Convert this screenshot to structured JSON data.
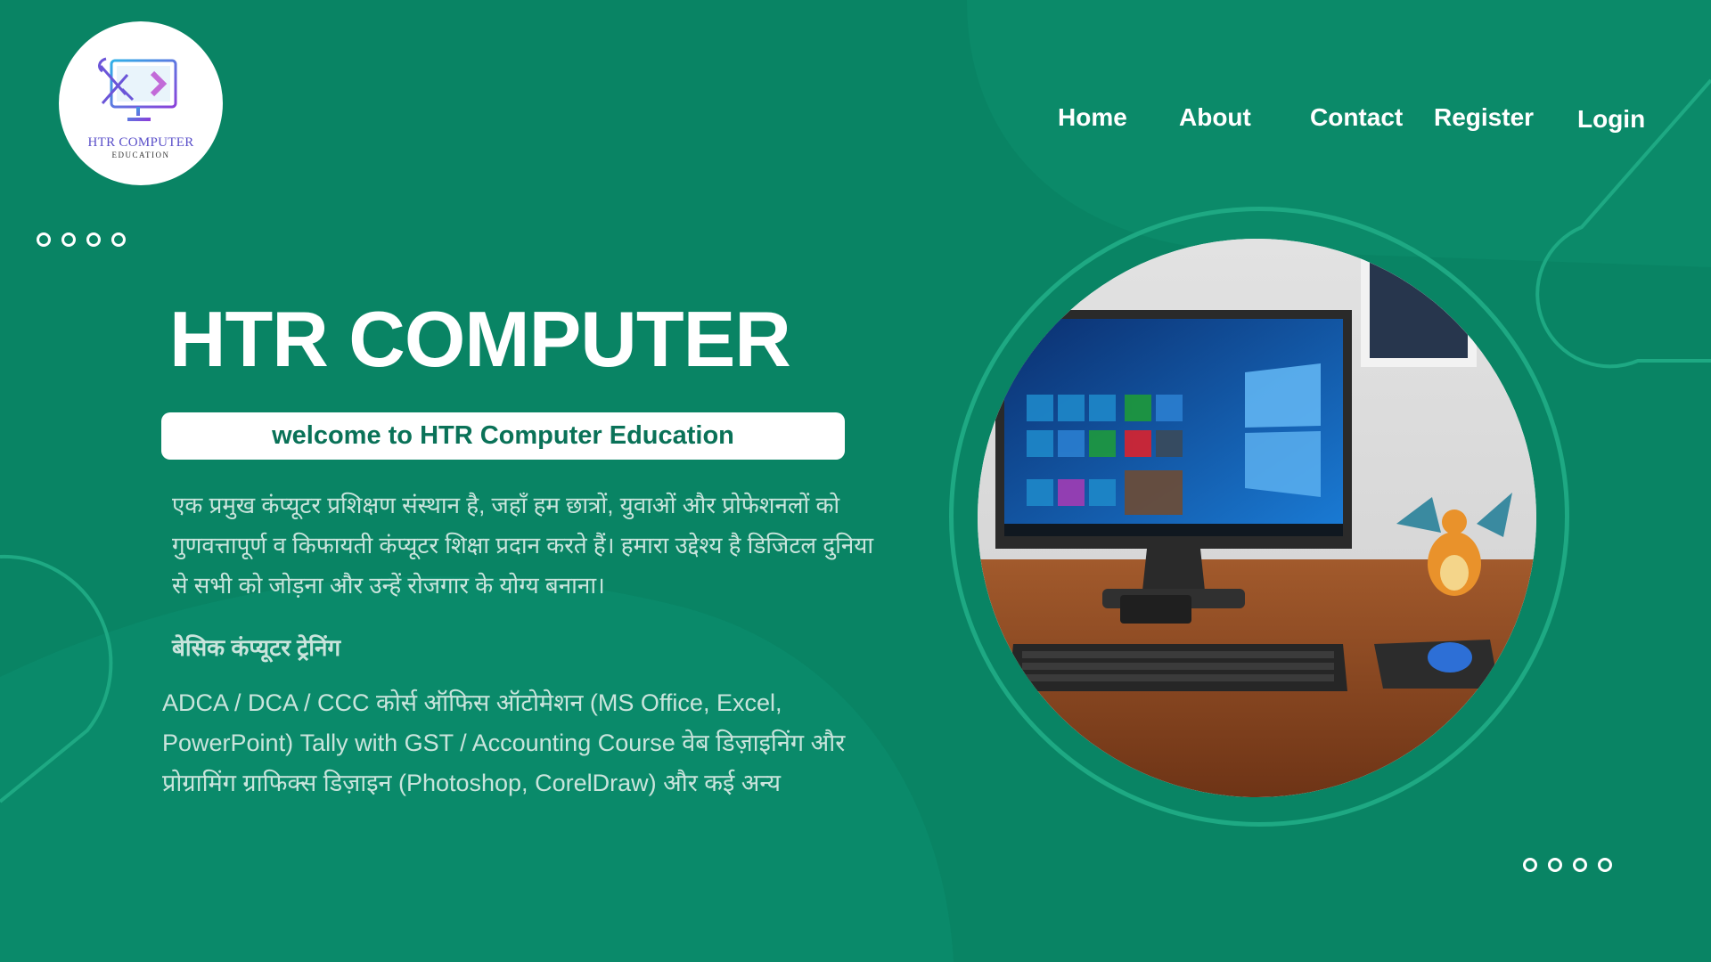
{
  "logo": {
    "line1": "HTR COMPUTER",
    "line2": "EDUCATION",
    "icon": "monitor-wrench-icon"
  },
  "nav": {
    "home": "Home",
    "about": "About",
    "contact": "Contact",
    "register": "Register",
    "login": "Login"
  },
  "hero": {
    "title": "HTR COMPUTER",
    "welcome": "welcome to HTR Computer Education",
    "description": "एक प्रमुख कंप्यूटर प्रशिक्षण संस्थान है, जहाँ हम छात्रों, युवाओं और प्रोफेशनलों को गुणवत्तापूर्ण व किफायती कंप्यूटर शिक्षा प्रदान करते हैं। हमारा उद्देश्य है डिजिटल दुनिया से सभी को जोड़ना और उन्हें रोजगार के योग्य बनाना।",
    "subheading": "बेसिक कंप्यूटर ट्रेनिंग",
    "courses": "ADCA / DCA / CCC कोर्स ऑफिस ऑटोमेशन (MS Office, Excel, PowerPoint) Tally with GST / Accounting Course वेब डिज़ाइनिंग और प्रोग्रामिंग ग्राफिक्स डिज़ाइन (Photoshop, CorelDraw) और कई अन्य",
    "image": "desktop-computer-photo"
  },
  "colors": {
    "background": "#098464",
    "accent": "#1ea983",
    "text_light": "#c9e4dc",
    "pill_text": "#0a7258"
  }
}
